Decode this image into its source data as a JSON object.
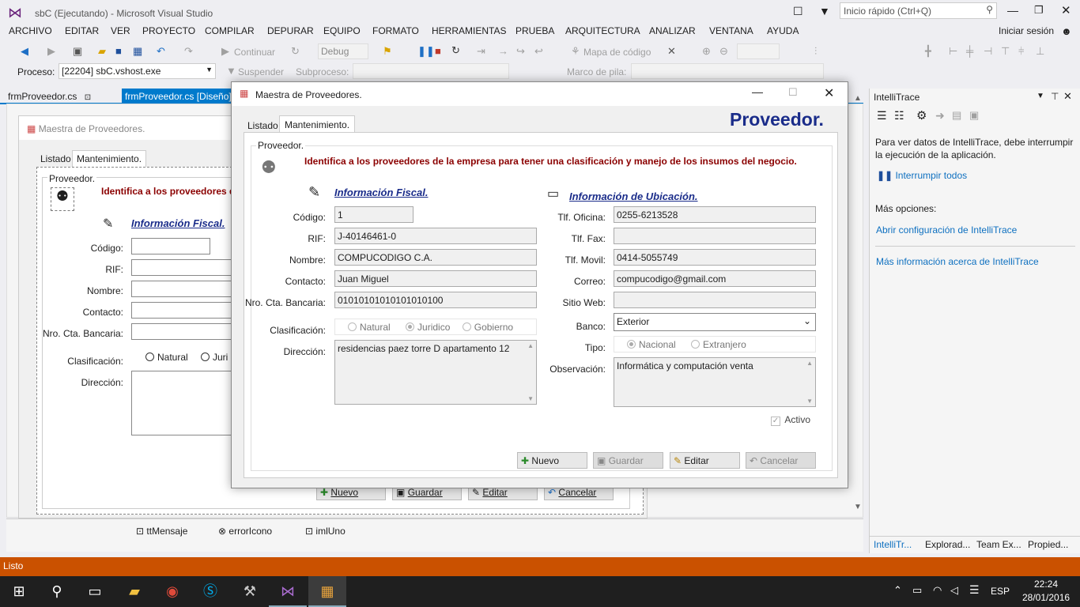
{
  "window": {
    "title": "sbC (Ejecutando) - Microsoft Visual Studio",
    "quick_launch": "Inicio rápido (Ctrl+Q)",
    "signin": "Iniciar sesión"
  },
  "menu": [
    "ARCHIVO",
    "EDITAR",
    "VER",
    "PROYECTO",
    "COMPILAR",
    "DEPURAR",
    "EQUIPO",
    "FORMATO",
    "HERRAMIENTAS",
    "PRUEBA",
    "ARQUITECTURA",
    "ANALIZAR",
    "VENTANA",
    "AYUDA"
  ],
  "toolbar": {
    "continue": "Continuar",
    "config": "Debug",
    "code_map": "Mapa de código",
    "process_label": "Proceso:",
    "process_value": "[22204] sbC.vshost.exe",
    "suspend": "Suspender",
    "subprocess": "Subproceso:",
    "stack": "Marco de pila:"
  },
  "tabs": {
    "tab1": "frmProveedor.cs",
    "tab2": "frmProveedor.cs [Diseño]"
  },
  "designer": {
    "form_title": "Maestra de Proveedores.",
    "tab_list": "Listado",
    "tab_maint": "Mantenimiento.",
    "group": "Proveedor.",
    "desc": "Identifica a los proveedores d",
    "fiscal": "Información Fiscal.",
    "labels": [
      "Código:",
      "RIF:",
      "Nombre:",
      "Contacto:",
      "Nro. Cta. Bancaria:"
    ],
    "clasif": "Clasificación:",
    "natural": "Natural",
    "juridico": "Juri",
    "direccion": "Dirección:",
    "btn_nuevo": "Nuevo",
    "btn_guardar": "Guardar",
    "btn_editar": "Editar",
    "btn_cancelar": "Cancelar"
  },
  "tray": {
    "item1": "ttMensaje",
    "item2": "errorIcono",
    "item3": "imlUno"
  },
  "dialog": {
    "title": "Maestra de Proveedores.",
    "tab_list": "Listado",
    "tab_maint": "Mantenimiento.",
    "heading": "Proveedor.",
    "group": "Proveedor.",
    "desc": "Identifica a los proveedores de la empresa para tener una clasificación y manejo de los insumos del negocio.",
    "fiscal_title": "Información Fiscal.",
    "ubic_title": "Información de Ubicación.",
    "codigo_label": "Código:",
    "codigo": "1",
    "rif_label": "RIF:",
    "rif": "J-40146461-0",
    "nombre_label": "Nombre:",
    "nombre": "COMPUCODIGO C.A.",
    "contacto_label": "Contacto:",
    "contacto": "Juan Miguel",
    "cuenta_label": "Nro. Cta. Bancaria:",
    "cuenta": "01010101010101010100",
    "clasif_label": "Clasificación:",
    "natural": "Natural",
    "juridico": "Juridico",
    "gobierno": "Gobierno",
    "direccion_label": "Dirección:",
    "direccion": "residencias paez torre D apartamento 12",
    "tlf_oficina_label": "Tlf. Oficina:",
    "tlf_oficina": "0255-6213528",
    "tlf_fax_label": "Tlf. Fax:",
    "tlf_fax": "",
    "tlf_movil_label": "Tlf. Movil:",
    "tlf_movil": "0414-5055749",
    "correo_label": "Correo:",
    "correo": "compucodigo@gmail.com",
    "web_label": "Sitio Web:",
    "web": "",
    "banco_label": "Banco:",
    "banco": "Exterior",
    "tipo_label": "Tipo:",
    "nacional": "Nacional",
    "extranjero": "Extranjero",
    "obs_label": "Observación:",
    "obs": "Informática y computación venta",
    "activo": "Activo",
    "btn_nuevo": "Nuevo",
    "btn_guardar": "Guardar",
    "btn_editar": "Editar",
    "btn_cancelar": "Cancelar"
  },
  "intellitrace": {
    "title": "IntelliTrace",
    "msg": "Para ver datos de IntelliTrace, debe interrumpir la ejecución de la aplicación.",
    "break_all": "Interrumpir todos",
    "more": "Más opciones:",
    "link1": "Abrir configuración de IntelliTrace",
    "link2": "Más información acerca de IntelliTrace",
    "bottom_tabs": [
      "IntelliTr...",
      "Explorad...",
      "Team Ex...",
      "Propied..."
    ]
  },
  "status": {
    "text": "Listo"
  },
  "taskbar": {
    "lang": "ESP",
    "time": "22:24",
    "date": "28/01/2016"
  },
  "colors": {
    "accent": "#ca5100",
    "vs_tab": "#007acc",
    "heading": "#1a2c8a",
    "desc": "#8b0000"
  }
}
